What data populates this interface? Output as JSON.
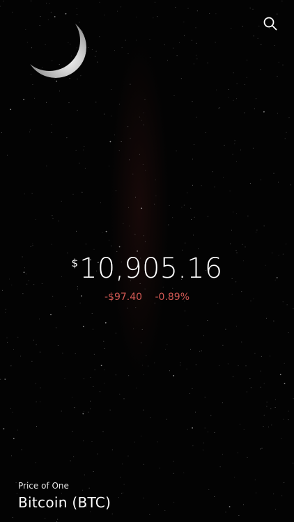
{
  "header": {
    "search_icon": "search-icon"
  },
  "background": {
    "moon_icon": "crescent-moon-icon"
  },
  "price": {
    "currency_symbol": "$",
    "value": "10,905.16",
    "change_amount": "-$97.40",
    "change_percent": "-0.89%"
  },
  "footer": {
    "caption": "Price of One",
    "asset_name": "Bitcoin (BTC)"
  },
  "colors": {
    "background": "#030303",
    "text": "#ffffff",
    "negative": "#d45a55"
  }
}
